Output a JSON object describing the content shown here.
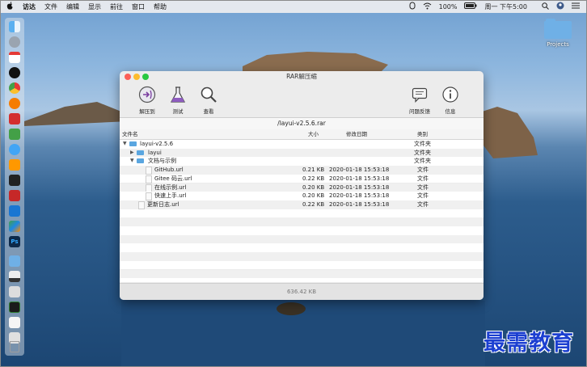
{
  "menubar": {
    "apple_icon": "apple-icon",
    "items": [
      "访达",
      "文件",
      "编辑",
      "显示",
      "前往",
      "窗口",
      "帮助"
    ],
    "battery": "100%",
    "clock": "周一 下午5:00"
  },
  "desktop": {
    "folder_label": "Projects"
  },
  "window": {
    "title": "RAR解压缩",
    "toolbar": {
      "extract_label": "解压到",
      "test_label": "测试",
      "view_label": "查看",
      "feedback_label": "问题反馈",
      "info_label": "信息"
    },
    "path": "/layui-v2.5.6.rar",
    "columns": {
      "name": "文件名",
      "size": "大小",
      "date": "修改日期",
      "kind": "类别"
    },
    "rows": [
      {
        "name": "layui-v2.5.6",
        "size": "",
        "date": "",
        "kind": "文件夹"
      },
      {
        "name": "layui",
        "size": "",
        "date": "",
        "kind": "文件夹"
      },
      {
        "name": "文档与示例",
        "size": "",
        "date": "",
        "kind": "文件夹"
      },
      {
        "name": "GitHub.url",
        "size": "0.21 KB",
        "date": "2020-01-18 15:53:18",
        "kind": "文件"
      },
      {
        "name": "Gitee 码云.url",
        "size": "0.22 KB",
        "date": "2020-01-18 15:53:18",
        "kind": "文件"
      },
      {
        "name": "在线示例.url",
        "size": "0.20 KB",
        "date": "2020-01-18 15:53:18",
        "kind": "文件"
      },
      {
        "name": "快速上手.url",
        "size": "0.20 KB",
        "date": "2020-01-18 15:53:18",
        "kind": "文件"
      },
      {
        "name": "更新日志.url",
        "size": "0.22 KB",
        "date": "2020-01-18 15:53:18",
        "kind": "文件"
      }
    ],
    "status": "636.42 KB"
  },
  "watermark": "最需教育",
  "colors": {
    "folder": "#5aa6e0",
    "close": "#fc5f57",
    "minimize": "#fdbc2e",
    "zoom": "#28c840",
    "watermark": "#1c3fd1"
  }
}
